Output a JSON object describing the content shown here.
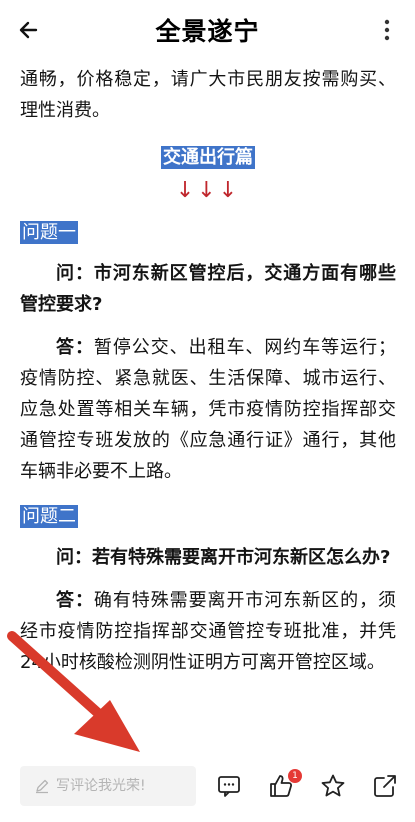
{
  "header": {
    "title": "全景遂宁"
  },
  "article": {
    "intro": "通畅，价格稳定，请广大市民朋友按需购买、理性消费。",
    "section_title": "交通出行篇",
    "arrows": "↓↓↓",
    "q1": {
      "label": "问题一",
      "question_prefix": "问：",
      "question": "市河东新区管控后，交通方面有哪些管控要求?",
      "answer_prefix": "答：",
      "answer": "暂停公交、出租车、网约车等运行；疫情防控、紧急就医、生活保障、城市运行、应急处置等相关车辆，凭市疫情防控指挥部交通管控专班发放的《应急通行证》通行，其他车辆非必要不上路。"
    },
    "q2": {
      "label": "问题二",
      "question_prefix": "问：",
      "question": "若有特殊需要离开市河东新区怎么办?",
      "answer_prefix": "答：",
      "answer": "确有特殊需要离开市河东新区的，须经市疫情防控指挥部交通管控专班批准，并凭24小时核酸检测阴性证明方可离开管控区域。"
    }
  },
  "bottom_bar": {
    "comment_placeholder": "写评论我光荣!",
    "like_badge": "1"
  },
  "colors": {
    "highlight": "#3f74c9",
    "arrow_red": "#d93a2b",
    "badge": "#e53935"
  }
}
